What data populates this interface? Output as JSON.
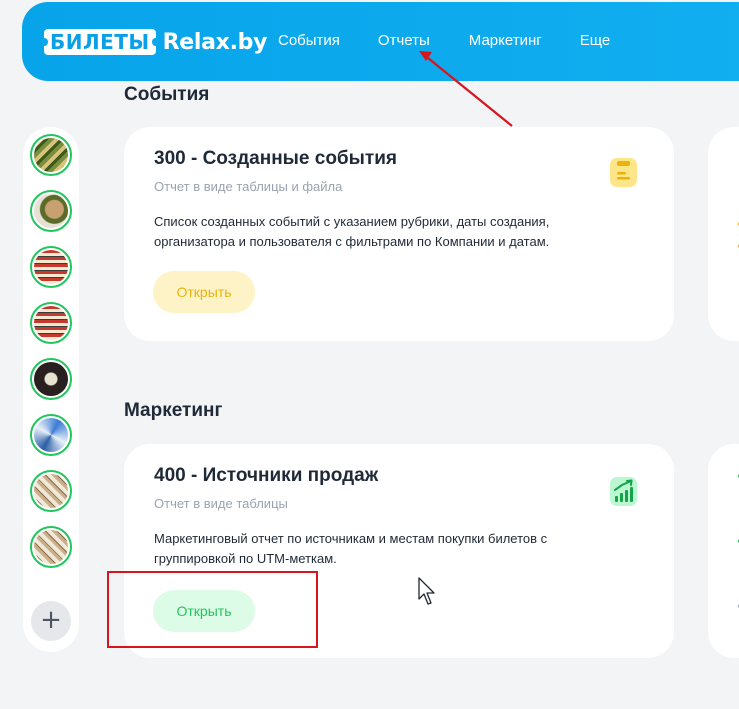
{
  "header": {
    "logo_box": "БИЛЕТЫ",
    "logo_text": "Relax.by",
    "nav": [
      "События",
      "Отчеты",
      "Маркетинг",
      "Еще"
    ]
  },
  "sidebar": {
    "avatars": [
      {
        "color": "#7a8f3d",
        "accent": "#d9c27a"
      },
      {
        "color": "#a8a08a",
        "accent": "#4a6b1f"
      },
      {
        "color": "#c53a2f",
        "accent": "#f5e9d0"
      },
      {
        "color": "#c53a2f",
        "accent": "#f5e9d0"
      },
      {
        "color": "#2a1f1f",
        "accent": "#e8e2d0"
      },
      {
        "color": "#3a7bd5",
        "accent": "#e8f0f8"
      },
      {
        "color": "#c9b08a",
        "accent": "#f2e8d8"
      },
      {
        "color": "#c9b08a",
        "accent": "#f2e8d8"
      }
    ],
    "add_label": "+"
  },
  "sections": [
    {
      "title": "События",
      "card": {
        "title": "300 - Созданные события",
        "subtitle": "Отчет в виде таблицы и файла",
        "description": "Список созданных событий с указанием рубрики, даты создания, организатора и пользователя с фильтрами по Компании и датам.",
        "button": "Открыть",
        "icon": "clipboard-icon",
        "accent": "#eab308"
      }
    },
    {
      "title": "Маркетинг",
      "card": {
        "title": "400 - Источники продаж",
        "subtitle": "Отчет в виде таблицы",
        "description": "Маркетинговый отчет по источникам и местам покупки билетов с группировкой по UTM-меткам.",
        "button": "Открыть",
        "icon": "growth-chart-icon",
        "accent": "#22c55e"
      }
    }
  ],
  "colors": {
    "header": "#0ea5e9",
    "background": "#f3f4f6",
    "annotation": "#d8141d"
  }
}
